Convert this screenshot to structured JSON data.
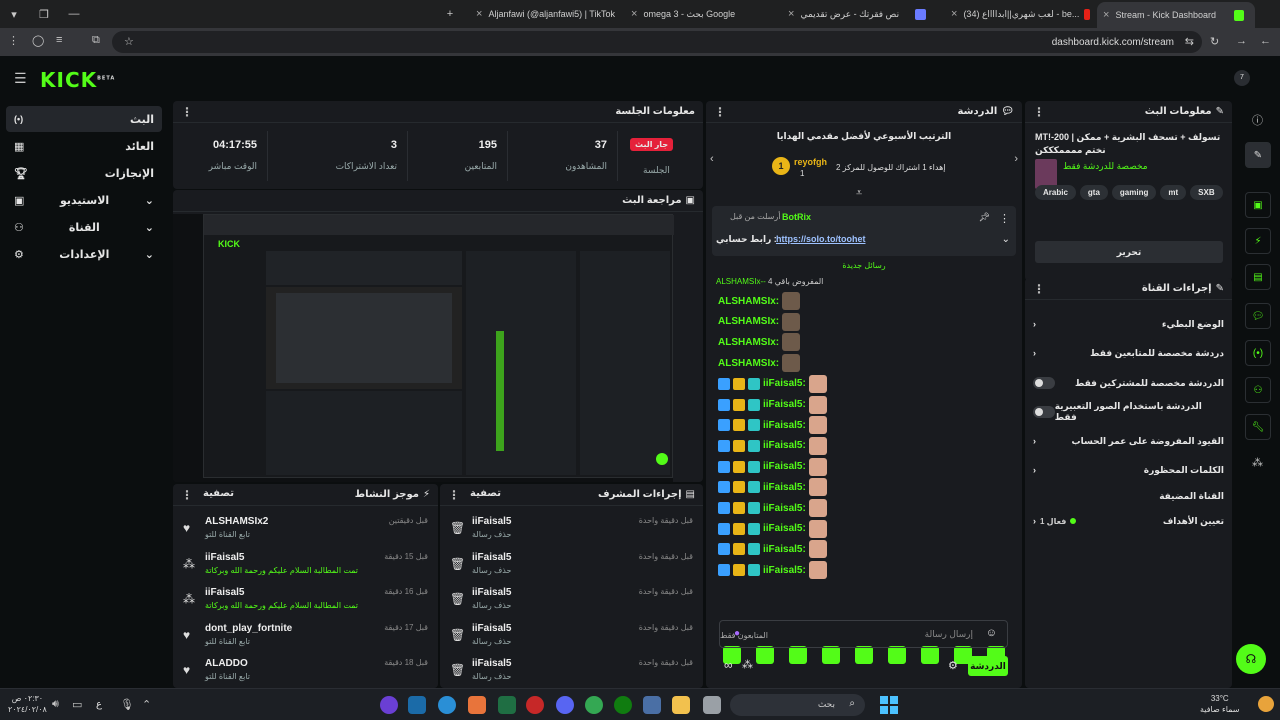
{
  "browser": {
    "tabs": [
      {
        "label": "Aljanfawi (@aljanfawi5) | TikTok"
      },
      {
        "label": "omega 3 - بحث Google"
      },
      {
        "label": "نص فقرتك - عرض تقديمي"
      },
      {
        "label": "(34) لعب شهري||ابدااااع - be..."
      },
      {
        "label": "Stream - Kick Dashboard"
      }
    ],
    "url": "dashboard.kick.com/stream"
  },
  "nav": {
    "items": [
      {
        "label": "البث"
      },
      {
        "label": "العائد"
      },
      {
        "label": "الإنجازات"
      },
      {
        "label": "الاستيديو"
      },
      {
        "label": "القناة"
      },
      {
        "label": "الإعدادات"
      }
    ],
    "avatar_count": "7"
  },
  "session": {
    "title": "معلومات الجلسة",
    "live_badge": "جار البث",
    "session_label": "الجلسة",
    "stats": [
      {
        "value": "04:17:55",
        "label": "الوقت مباشر"
      },
      {
        "value": "3",
        "label": "تعداد الاشتراكات"
      },
      {
        "value": "195",
        "label": "المتابعين"
      },
      {
        "value": "37",
        "label": "المشاهدون"
      }
    ]
  },
  "preview": {
    "title": "مراجعة البث"
  },
  "feed": {
    "title": "موجز النشاط",
    "filter": "تصفية",
    "rows": [
      {
        "name": "ALSHAMSIx2",
        "sub": "تابع القناة للتو",
        "time": "قبل دقيقتين"
      },
      {
        "name": "iiFaisal5",
        "sub": "تمت المطالبة السلام عليكم ورحمة الله وبركاتة",
        "time": "قبل 15 دقيقة"
      },
      {
        "name": "iiFaisal5",
        "sub": "تمت المطالبة السلام عليكم ورحمة الله وبركاتة",
        "time": "قبل 16 دقيقة"
      },
      {
        "name": "dont_play_fortnite",
        "sub": "تابع القناة للتو",
        "time": "قبل 17 دقيقة"
      },
      {
        "name": "ALADDO",
        "sub": "تابع القناة للتو",
        "time": "قبل 18 دقيقة"
      }
    ]
  },
  "modactions": {
    "title": "إجراءات المشرف",
    "filter": "تصفية",
    "rows": [
      {
        "name": "iiFaisal5",
        "sub": "حذف رسالة",
        "time": "قبل دقيقة واحدة"
      },
      {
        "name": "iiFaisal5",
        "sub": "حذف رسالة",
        "time": "قبل دقيقة واحدة"
      },
      {
        "name": "iiFaisal5",
        "sub": "حذف رسالة",
        "time": "قبل دقيقة واحدة"
      },
      {
        "name": "iiFaisal5",
        "sub": "حذف رسالة",
        "time": "قبل دقيقة واحدة"
      },
      {
        "name": "iiFaisal5",
        "sub": "حذف رسالة",
        "time": "قبل دقيقة واحدة"
      }
    ]
  },
  "chat": {
    "title": "الدردشة",
    "leaderboard_title": "الترتيب الأسبوعي لأفضل مقدمي الهدايا",
    "top_gifter": "reyofgh",
    "top_gifter_count": "1",
    "goal_text": "إهداء 1 اشتراك للوصول للمركز 2",
    "pinned_by": "أرسلت من قبل",
    "pinned_user": "BotRix",
    "pinned_text": "رابط حسابي :",
    "pinned_link": "https://solo.to/toohet",
    "new_messages": "رسائل جديدة",
    "timeout_text": "المفروض باقي 4",
    "timeout_user": "ALSHAMSIx--",
    "messages": [
      {
        "user": "ALSHAMSIx:"
      },
      {
        "user": "ALSHAMSIx:"
      },
      {
        "user": "ALSHAMSIx:"
      },
      {
        "user": "ALSHAMSIx:"
      },
      {
        "user": "iiFaisal5:"
      },
      {
        "user": "iiFaisal5:"
      },
      {
        "user": "iiFaisal5:"
      },
      {
        "user": "iiFaisal5:"
      },
      {
        "user": "iiFaisal5:"
      },
      {
        "user": "iiFaisal5:"
      },
      {
        "user": "iiFaisal5:"
      },
      {
        "user": "iiFaisal5:"
      },
      {
        "user": "iiFaisal5:"
      },
      {
        "user": "iiFaisal5:"
      }
    ],
    "followers_only": "المتابعون فقط",
    "input_placeholder": "إرسال رسالة",
    "send_label": "الدردشة"
  },
  "streaminfo": {
    "title": "معلومات البث",
    "stream_title": "MT!-200 | تسولف + تسحف البشرية + ممكن نختم ممممكككن",
    "category": "مخصصة للدردشة فقط",
    "tags": [
      "SXB",
      "mt",
      "gaming",
      "gta",
      "Arabic"
    ],
    "edit_label": "تحرير"
  },
  "channelactions": {
    "title": "إجراءات القناة",
    "items": [
      {
        "label": "الوضع البطيء"
      },
      {
        "label": "دردشة مخصصة للمتابعين فقط"
      },
      {
        "label": "الدردشة مخصصة للمشتركين فقط"
      },
      {
        "label": "الدردشة باستخدام الصور التعبيرية فقط"
      },
      {
        "label": "القيود المفروضة على عمر الحساب"
      },
      {
        "label": "الكلمات المحظورة"
      }
    ],
    "poll_label": "القناة المضيفة",
    "goals_label": "تعيين الأهداف",
    "goals_status": "فعال 1"
  },
  "taskbar": {
    "search_placeholder": "بحث",
    "time": "٠٢:٣٠ ص",
    "date": "٢٠٢٤/٠٢/٠٨",
    "lang": "ع",
    "weather_temp": "33°C",
    "weather_desc": "سماء صافية"
  },
  "colors": {
    "accent": "#53fc18",
    "live": "#e5213a",
    "panel": "#191b1f"
  }
}
